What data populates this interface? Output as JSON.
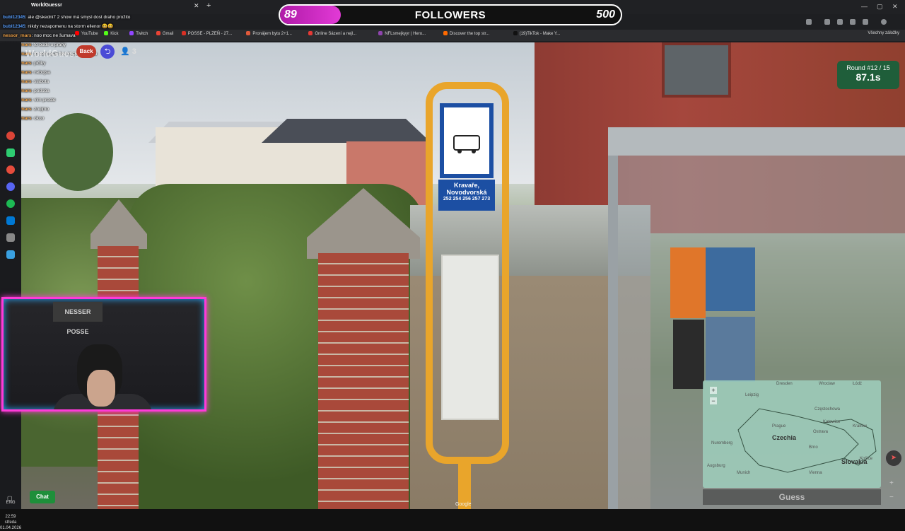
{
  "browser": {
    "tab_title": "WorldGuessr",
    "bookmarks": [
      {
        "label": "YouTube",
        "color": "#ff0000"
      },
      {
        "label": "Kick",
        "color": "#53fc18"
      },
      {
        "label": "Twitch",
        "color": "#9146ff"
      },
      {
        "label": "Gmail",
        "color": "#ea4335"
      },
      {
        "label": "POSSE - PLZEŇ - 27...",
        "color": "#d93025"
      },
      {
        "label": "Pronájem bytu 2+1...",
        "color": "#e05a3b"
      },
      {
        "label": "Online Sázení a nejl...",
        "color": "#e53935"
      },
      {
        "label": "NFLsmejkyyr | Hero...",
        "color": "#8e44ad"
      },
      {
        "label": "Discover the top str...",
        "color": "#ff6a00"
      },
      {
        "label": "(19)TikTok - Make Y...",
        "color": "#111111"
      }
    ],
    "all_bookmarks": "Všechny záložky"
  },
  "followers": {
    "current": "89",
    "label": "FOLLOWERS",
    "goal": "500",
    "fill_fraction": 0.178
  },
  "chat": [
    {
      "user": "bubl12345",
      "text": "ale @skedni7 2 show má smysl dost draho prožito"
    },
    {
      "user": "bubl12345",
      "text": "nikdy nezapomenu na storm ellenor 😆😆"
    },
    {
      "user": "nessor_mars",
      "text": "noo moc ne šumava"
    },
    {
      "user": "nessor_mars",
      "text": "to bude u prahy"
    },
    {
      "user": "nessor_mars",
      "text": "to sem psal dve lokace dozadu"
    },
    {
      "user": "nessor_mars",
      "text": "pičiky"
    },
    {
      "user": "nessor_mars",
      "text": "nebojsa"
    },
    {
      "user": "nessor_mars",
      "text": "slabota"
    },
    {
      "user": "nessor_mars",
      "text": "podoba"
    },
    {
      "user": "nessor_mars",
      "text": "vím proste"
    },
    {
      "user": "nessor_mars",
      "text": "znojmo"
    },
    {
      "user": "nessor_mars",
      "text": "okoo"
    }
  ],
  "game": {
    "title": "WorldGuessr",
    "back_label": "Back",
    "players_count": "3",
    "round_label": "Round #12 / 15",
    "time_label": "87.1s",
    "guess_label": "Guess",
    "stop_name_line1": "Kravaře,",
    "stop_name_line2": "Novodvorská",
    "stop_lines": "252 254 256 257 273",
    "google_mark": "Google"
  },
  "minimap": {
    "labels": [
      {
        "text": "Leipzig",
        "big": false
      },
      {
        "text": "Dresden",
        "big": false
      },
      {
        "text": "Wrocław",
        "big": false
      },
      {
        "text": "Częstochowa",
        "big": false
      },
      {
        "text": "Łódź",
        "big": false
      },
      {
        "text": "Katowice",
        "big": false
      },
      {
        "text": "Kraków",
        "big": false
      },
      {
        "text": "Prague",
        "big": false
      },
      {
        "text": "Czechia",
        "big": true
      },
      {
        "text": "Ostrava",
        "big": false
      },
      {
        "text": "Brno",
        "big": false
      },
      {
        "text": "Nuremberg",
        "big": false
      },
      {
        "text": "Slovakia",
        "big": true
      },
      {
        "text": "Košice",
        "big": false
      },
      {
        "text": "Munich",
        "big": false
      },
      {
        "text": "Vienna",
        "big": false
      },
      {
        "text": "Augsburg",
        "big": false
      }
    ],
    "zoom_in": "+",
    "zoom_out": "−"
  },
  "taskbar": {
    "lang": "ENG",
    "time": "22:59",
    "day": "středa",
    "date": "01.04.2026"
  },
  "webcam": {
    "banner": "NESSER POSSE"
  },
  "chat_button": "Chat"
}
